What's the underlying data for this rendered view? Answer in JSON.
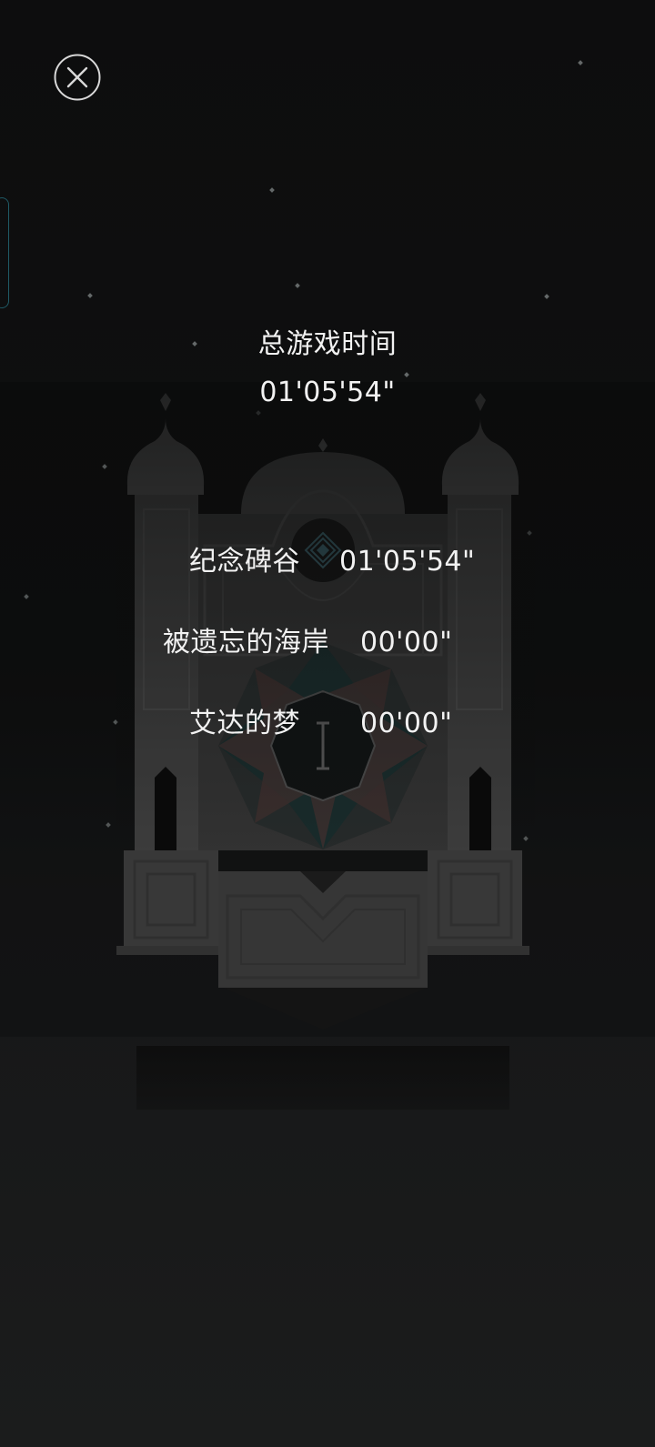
{
  "summary": {
    "total_label": "总游戏时间",
    "total_time": "01'05'54\""
  },
  "chapters": [
    {
      "name": "纪念碑谷",
      "time": "01'05'54\""
    },
    {
      "name": "被遗忘的海岸",
      "time": "00'00\""
    },
    {
      "name": "艾达的梦",
      "time": "00'00\""
    }
  ],
  "colors": {
    "background": "#0f1010",
    "monument": "#4a4a4a",
    "text": "#f2f2f2",
    "accent": "#1f5a66"
  },
  "icons": {
    "close": "close-icon",
    "emblem": "diamond-emblem-icon",
    "chapter_mark": "roman-numeral-one-icon"
  }
}
